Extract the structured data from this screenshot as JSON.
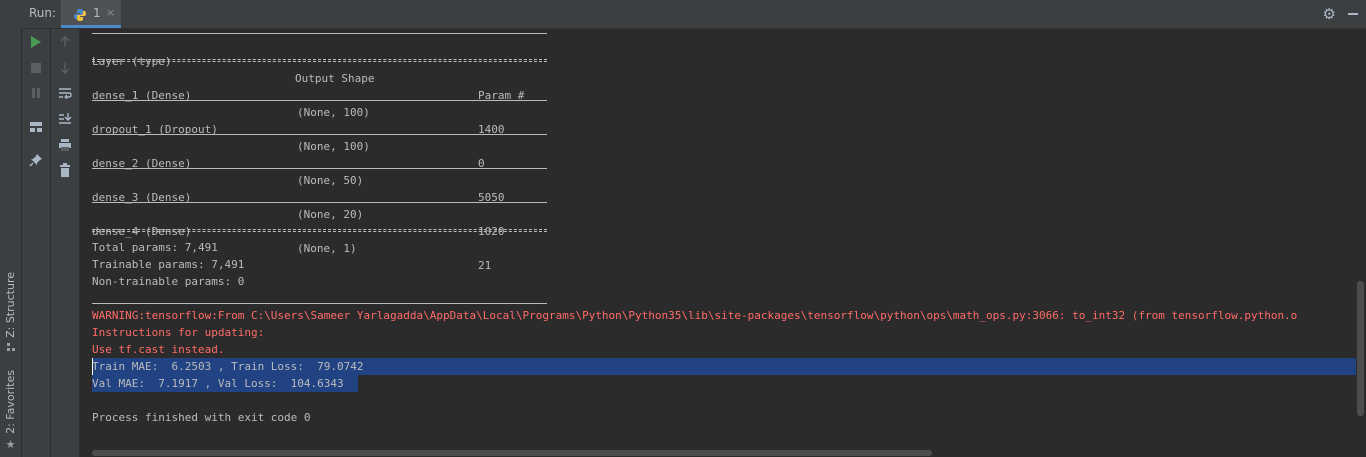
{
  "window": {
    "run_label": "Run:",
    "tab_label": "1",
    "tab_close": "×"
  },
  "sidebar": {
    "structure_label": "Z: Structure",
    "favorites_label": "2: Favorites"
  },
  "colors": {
    "background": "#2b2b2b",
    "panel": "#3c3f41",
    "text": "#bbbbbb",
    "error": "#ff6b68",
    "selection": "#214283",
    "run_green": "#499c54"
  },
  "icons": {
    "toolbar1": [
      "run-icon",
      "stop-icon",
      "pause-icon",
      "layout-icon",
      "pin-icon"
    ],
    "toolbar2": [
      "up-arrow-icon",
      "down-arrow-icon",
      "soft-wrap-icon",
      "scroll-to-end-icon",
      "print-icon",
      "trash-icon"
    ]
  },
  "console": {
    "headers": {
      "layer": "Layer (type)",
      "shape": "Output Shape",
      "params": "Param #"
    },
    "rows": [
      {
        "layer": "dense_1 (Dense)",
        "shape": "(None, 100)",
        "params": "1400"
      },
      {
        "layer": "dropout_1 (Dropout)",
        "shape": "(None, 100)",
        "params": "0"
      },
      {
        "layer": "dense_2 (Dense)",
        "shape": "(None, 50)",
        "params": "5050"
      },
      {
        "layer": "dense_3 (Dense)",
        "shape": "(None, 20)",
        "params": "1020"
      },
      {
        "layer": "dense_4 (Dense)",
        "shape": "(None, 1)",
        "params": "21"
      }
    ],
    "total_params": "Total params: 7,491",
    "trainable_params": "Trainable params: 7,491",
    "non_trainable_params": "Non-trainable params: 0",
    "warning": "WARNING:tensorflow:From C:\\Users\\Sameer Yarlagadda\\AppData\\Local\\Programs\\Python\\Python35\\lib\\site-packages\\tensorflow\\python\\ops\\math_ops.py:3066: to_int32 (from tensorflow.python.o",
    "instructions": "Instructions for updating:",
    "use_cast": "Use tf.cast instead.",
    "train_line": "Train MAE:  6.2503 , Train Loss:  79.0742",
    "val_line": "Val MAE:  7.1917 , Val Loss:  104.6343",
    "exit_line": "Process finished with exit code 0"
  }
}
